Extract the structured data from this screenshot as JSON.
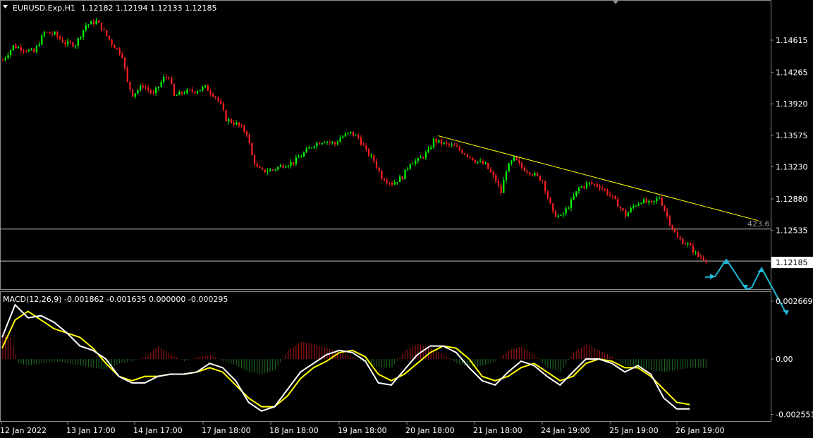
{
  "header": {
    "symbol": "EURUSD.Exp,H1",
    "ohlc": "1.12182 1.12194 1.12133 1.12185"
  },
  "macd_header": {
    "label": "MACD(12,26,9) -0.001862 -0.001635 0.000000 -0.000295"
  },
  "colors": {
    "background": "#000000",
    "bull_candle": "#00ff00",
    "bear_candle": "#ff2020",
    "trendline": "#ffff00",
    "hline": "#c0c0c0",
    "forecast_arrow": "#20b8d8",
    "macd_main": "#ffffff",
    "macd_signal": "#ffff00",
    "hist_pos": "#b01818",
    "hist_neg": "#1f6f1f"
  },
  "chart_data": [
    {
      "type": "candlestick",
      "title": "EURUSD.Exp,H1",
      "price_ticks": [
        "1.14615",
        "1.14265",
        "1.13920",
        "1.13575",
        "1.13230",
        "1.12880",
        "1.12535"
      ],
      "current_price_label": "1.12185",
      "ylim": [
        1.1197,
        1.149
      ],
      "horizontal_lines": [
        1.1255,
        1.122
      ],
      "fib_label": "423.6",
      "trendline": {
        "from": {
          "bar": 168,
          "price": 1.1357
        },
        "to": {
          "bar": 275,
          "price": 1.1262
        }
      },
      "x_tick_labels": [
        "12 Jan 2022",
        "13 Jan 17:00",
        "14 Jan 17:00",
        "17 Jan 18:00",
        "18 Jan 18:00",
        "19 Jan 18:00",
        "20 Jan 18:00",
        "21 Jan 18:00",
        "24 Jan 19:00",
        "25 Jan 19:00",
        "26 Jan 19:00"
      ],
      "close_path": [
        [
          0,
          1.144
        ],
        [
          4,
          1.1455
        ],
        [
          8,
          1.1452
        ],
        [
          12,
          1.1448
        ],
        [
          16,
          1.147
        ],
        [
          20,
          1.1468
        ],
        [
          24,
          1.1458
        ],
        [
          28,
          1.1457
        ],
        [
          32,
          1.1478
        ],
        [
          36,
          1.1482
        ],
        [
          38,
          1.1475
        ],
        [
          42,
          1.1458
        ],
        [
          46,
          1.1445
        ],
        [
          48,
          1.1415
        ],
        [
          50,
          1.1402
        ],
        [
          54,
          1.1412
        ],
        [
          58,
          1.1402
        ],
        [
          62,
          1.142
        ],
        [
          64,
          1.1422
        ],
        [
          66,
          1.14
        ],
        [
          70,
          1.1405
        ],
        [
          74,
          1.1406
        ],
        [
          78,
          1.141
        ],
        [
          82,
          1.14
        ],
        [
          84,
          1.139
        ],
        [
          86,
          1.1375
        ],
        [
          90,
          1.137
        ],
        [
          94,
          1.136
        ],
        [
          96,
          1.1335
        ],
        [
          98,
          1.1322
        ],
        [
          100,
          1.1318
        ],
        [
          104,
          1.132
        ],
        [
          108,
          1.1325
        ],
        [
          112,
          1.1328
        ],
        [
          116,
          1.1338
        ],
        [
          120,
          1.1348
        ],
        [
          124,
          1.1352
        ],
        [
          128,
          1.1348
        ],
        [
          130,
          1.1355
        ],
        [
          134,
          1.136
        ],
        [
          137,
          1.1355
        ],
        [
          140,
          1.134
        ],
        [
          143,
          1.133
        ],
        [
          146,
          1.1312
        ],
        [
          150,
          1.1305
        ],
        [
          154,
          1.1312
        ],
        [
          157,
          1.1328
        ],
        [
          160,
          1.133
        ],
        [
          164,
          1.134
        ],
        [
          166,
          1.1352
        ],
        [
          170,
          1.1348
        ],
        [
          174,
          1.1345
        ],
        [
          178,
          1.1338
        ],
        [
          182,
          1.133
        ],
        [
          186,
          1.1325
        ],
        [
          190,
          1.1308
        ],
        [
          192,
          1.1295
        ],
        [
          194,
          1.132
        ],
        [
          197,
          1.1332
        ],
        [
          200,
          1.1322
        ],
        [
          204,
          1.1316
        ],
        [
          208,
          1.1308
        ],
        [
          210,
          1.129
        ],
        [
          212,
          1.1272
        ],
        [
          215,
          1.1268
        ],
        [
          218,
          1.128
        ],
        [
          222,
          1.13
        ],
        [
          226,
          1.1305
        ],
        [
          230,
          1.1302
        ],
        [
          234,
          1.1292
        ],
        [
          237,
          1.1282
        ],
        [
          240,
          1.127
        ],
        [
          243,
          1.128
        ],
        [
          246,
          1.1286
        ],
        [
          250,
          1.1282
        ],
        [
          253,
          1.129
        ],
        [
          257,
          1.1262
        ],
        [
          260,
          1.1245
        ],
        [
          264,
          1.1238
        ],
        [
          268,
          1.1225
        ],
        [
          271,
          1.1222
        ]
      ]
    },
    {
      "type": "line",
      "title": "MACD(12,26,9)",
      "values_label": "-0.001862 -0.001635 0.000000 -0.000295",
      "y_ticks": [
        "0.002669",
        "0.00",
        "-0.002551"
      ],
      "ylim": [
        -0.0027,
        0.0028
      ],
      "series": [
        {
          "name": "MACD",
          "color": "#ffffff",
          "points": [
            [
              0,
              0.001
            ],
            [
              5,
              0.0025
            ],
            [
              10,
              0.0019
            ],
            [
              15,
              0.002
            ],
            [
              20,
              0.0017
            ],
            [
              25,
              0.0012
            ],
            [
              30,
              0.0006
            ],
            [
              35,
              0.0004
            ],
            [
              40,
              0.0
            ],
            [
              45,
              -0.0008
            ],
            [
              50,
              -0.0011
            ],
            [
              55,
              -0.0011
            ],
            [
              60,
              -0.0008
            ],
            [
              65,
              -0.0007
            ],
            [
              70,
              -0.0007
            ],
            [
              75,
              -0.0006
            ],
            [
              80,
              -0.0002
            ],
            [
              85,
              -0.0004
            ],
            [
              90,
              -0.001
            ],
            [
              95,
              -0.002
            ],
            [
              100,
              -0.0024
            ],
            [
              105,
              -0.0022
            ],
            [
              110,
              -0.0014
            ],
            [
              115,
              -0.0006
            ],
            [
              120,
              -0.0002
            ],
            [
              125,
              0.0002
            ],
            [
              130,
              0.0004
            ],
            [
              135,
              0.0003
            ],
            [
              140,
              -0.0001
            ],
            [
              145,
              -0.0011
            ],
            [
              150,
              -0.0012
            ],
            [
              155,
              -0.0005
            ],
            [
              160,
              0.0002
            ],
            [
              165,
              0.0006
            ],
            [
              170,
              0.0006
            ],
            [
              175,
              0.0003
            ],
            [
              180,
              -0.0004
            ],
            [
              185,
              -0.001
            ],
            [
              190,
              -0.0012
            ],
            [
              195,
              -0.0006
            ],
            [
              200,
              -0.0001
            ],
            [
              205,
              -0.0003
            ],
            [
              210,
              -0.0008
            ],
            [
              215,
              -0.0012
            ],
            [
              220,
              -0.0006
            ],
            [
              225,
              0.0
            ],
            [
              230,
              0.0
            ],
            [
              235,
              -0.0002
            ],
            [
              240,
              -0.0006
            ],
            [
              245,
              -0.0003
            ],
            [
              250,
              -0.0007
            ],
            [
              255,
              -0.0018
            ],
            [
              260,
              -0.0023
            ],
            [
              265,
              -0.0023
            ]
          ]
        },
        {
          "name": "Signal",
          "color": "#ffff00",
          "points": [
            [
              0,
              0.0005
            ],
            [
              5,
              0.0018
            ],
            [
              10,
              0.0022
            ],
            [
              15,
              0.0018
            ],
            [
              20,
              0.0014
            ],
            [
              25,
              0.0012
            ],
            [
              30,
              0.001
            ],
            [
              35,
              0.0005
            ],
            [
              40,
              -0.0002
            ],
            [
              45,
              -0.0008
            ],
            [
              50,
              -0.001
            ],
            [
              55,
              -0.0008
            ],
            [
              60,
              -0.0008
            ],
            [
              65,
              -0.0007
            ],
            [
              70,
              -0.0007
            ],
            [
              75,
              -0.0006
            ],
            [
              80,
              -0.0004
            ],
            [
              85,
              -0.0006
            ],
            [
              90,
              -0.0012
            ],
            [
              95,
              -0.0018
            ],
            [
              100,
              -0.0022
            ],
            [
              105,
              -0.0022
            ],
            [
              110,
              -0.0017
            ],
            [
              115,
              -0.0009
            ],
            [
              120,
              -0.0004
            ],
            [
              125,
              -0.0001
            ],
            [
              130,
              0.0003
            ],
            [
              135,
              0.0004
            ],
            [
              140,
              0.0001
            ],
            [
              145,
              -0.0007
            ],
            [
              150,
              -0.001
            ],
            [
              155,
              -0.0007
            ],
            [
              160,
              -0.0002
            ],
            [
              165,
              0.0003
            ],
            [
              170,
              0.0006
            ],
            [
              175,
              0.0005
            ],
            [
              180,
              0.0
            ],
            [
              185,
              -0.0008
            ],
            [
              190,
              -0.001
            ],
            [
              195,
              -0.0008
            ],
            [
              200,
              -0.0004
            ],
            [
              205,
              -0.0002
            ],
            [
              210,
              -0.0006
            ],
            [
              215,
              -0.001
            ],
            [
              220,
              -0.0008
            ],
            [
              225,
              -0.0002
            ],
            [
              230,
              0.0
            ],
            [
              235,
              -0.0001
            ],
            [
              240,
              -0.0004
            ],
            [
              245,
              -0.0004
            ],
            [
              250,
              -0.0008
            ],
            [
              255,
              -0.0014
            ],
            [
              260,
              -0.002
            ],
            [
              265,
              -0.0021
            ]
          ]
        }
      ],
      "histogram": [
        [
          0,
          0.0012
        ],
        [
          3,
          0.001
        ],
        [
          6,
          -0.0002
        ],
        [
          10,
          -0.0003
        ],
        [
          15,
          -0.0002
        ],
        [
          20,
          -0.0001
        ],
        [
          25,
          -0.0002
        ],
        [
          30,
          -0.0003
        ],
        [
          35,
          -0.0004
        ],
        [
          40,
          -0.0005
        ],
        [
          45,
          -0.0002
        ],
        [
          50,
          -0.0001
        ],
        [
          55,
          0.0001
        ],
        [
          60,
          0.0006
        ],
        [
          65,
          0.0002
        ],
        [
          70,
          -0.0001
        ],
        [
          75,
          0.0001
        ],
        [
          80,
          0.0002
        ],
        [
          85,
          -0.0001
        ],
        [
          90,
          -0.0003
        ],
        [
          95,
          -0.0006
        ],
        [
          100,
          -0.0007
        ],
        [
          105,
          -0.0005
        ],
        [
          110,
          0.0004
        ],
        [
          115,
          0.0008
        ],
        [
          120,
          0.0007
        ],
        [
          125,
          0.0005
        ],
        [
          130,
          0.0003
        ],
        [
          135,
          0.0001
        ],
        [
          140,
          -0.0002
        ],
        [
          145,
          -0.0004
        ],
        [
          150,
          -0.0004
        ],
        [
          155,
          0.0004
        ],
        [
          160,
          0.0007
        ],
        [
          165,
          0.0005
        ],
        [
          170,
          0.0002
        ],
        [
          175,
          -0.0002
        ],
        [
          180,
          -0.0004
        ],
        [
          185,
          -0.0003
        ],
        [
          190,
          -0.0001
        ],
        [
          195,
          0.0004
        ],
        [
          200,
          0.0006
        ],
        [
          205,
          0.0002
        ],
        [
          210,
          -0.0004
        ],
        [
          215,
          -0.0006
        ],
        [
          220,
          0.0003
        ],
        [
          225,
          0.0007
        ],
        [
          230,
          0.0004
        ],
        [
          235,
          0.0001
        ],
        [
          240,
          -0.0003
        ],
        [
          245,
          -0.0004
        ],
        [
          250,
          -0.0005
        ],
        [
          255,
          -0.0006
        ],
        [
          260,
          -0.0005
        ],
        [
          265,
          -0.0004
        ]
      ]
    }
  ]
}
